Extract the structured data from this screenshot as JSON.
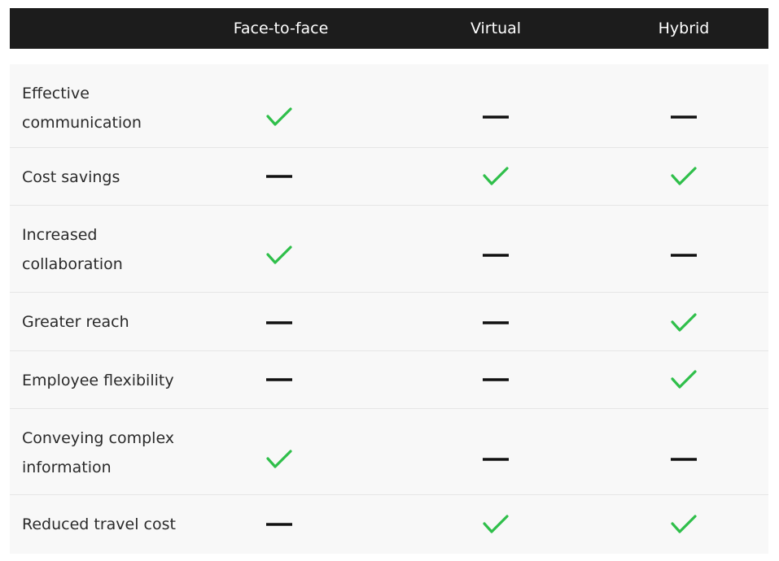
{
  "columns": [
    "Face-to-face",
    "Virtual",
    "Hybrid"
  ],
  "rows": [
    {
      "label": "Effective communication",
      "lines": [
        "Effective",
        "communication"
      ],
      "values": [
        "check",
        "dash",
        "dash"
      ]
    },
    {
      "label": "Cost savings",
      "lines": [
        "Cost savings"
      ],
      "values": [
        "dash",
        "check",
        "check"
      ]
    },
    {
      "label": "Increased collaboration",
      "lines": [
        "Increased",
        "collaboration"
      ],
      "values": [
        "check",
        "dash",
        "dash"
      ]
    },
    {
      "label": "Greater reach",
      "lines": [
        "Greater reach"
      ],
      "values": [
        "dash",
        "dash",
        "check"
      ]
    },
    {
      "label": "Employee flexibility",
      "lines": [
        "Employee flexibility"
      ],
      "values": [
        "dash",
        "dash",
        "check"
      ]
    },
    {
      "label": "Conveying complex information",
      "lines": [
        "Conveying complex",
        "information"
      ],
      "values": [
        "check",
        "dash",
        "dash"
      ]
    },
    {
      "label": "Reduced travel cost",
      "lines": [
        "Reduced travel cost"
      ],
      "values": [
        "dash",
        "check",
        "check"
      ]
    }
  ],
  "colors": {
    "header_bg": "#1c1c1c",
    "row_bg": "#f8f8f8",
    "check": "#2fbf4a",
    "dash": "#111111"
  }
}
